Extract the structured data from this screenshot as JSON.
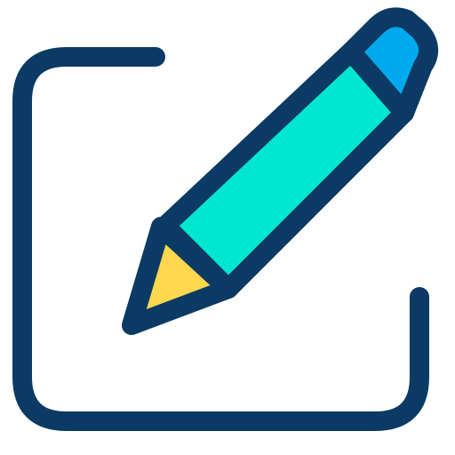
{
  "icon": {
    "name": "edit-icon",
    "colors": {
      "outline": "#0B3A64",
      "pencil_body": "#00E6D0",
      "pencil_eraser": "#00A9EE",
      "pencil_tip": "#FFD84D",
      "background": "#FFFFFF"
    }
  }
}
